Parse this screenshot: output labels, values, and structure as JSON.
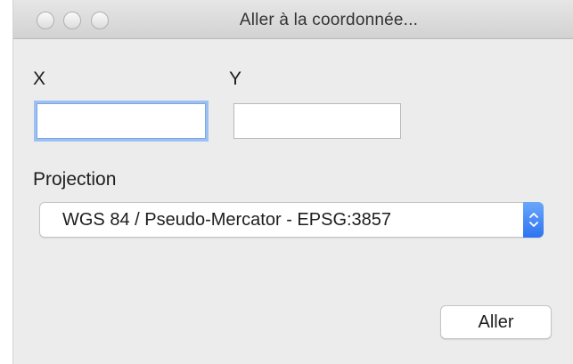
{
  "window": {
    "title": "Aller à la coordonnée..."
  },
  "fields": {
    "x_label": "X",
    "y_label": "Y",
    "x_value": "",
    "y_value": ""
  },
  "projection": {
    "label": "Projection",
    "selected": "WGS 84 / Pseudo-Mercator - EPSG:3857"
  },
  "actions": {
    "go_label": "Aller"
  },
  "colors": {
    "focus_ring": "#9cc0f2",
    "select_accent": "#2d74f0"
  }
}
